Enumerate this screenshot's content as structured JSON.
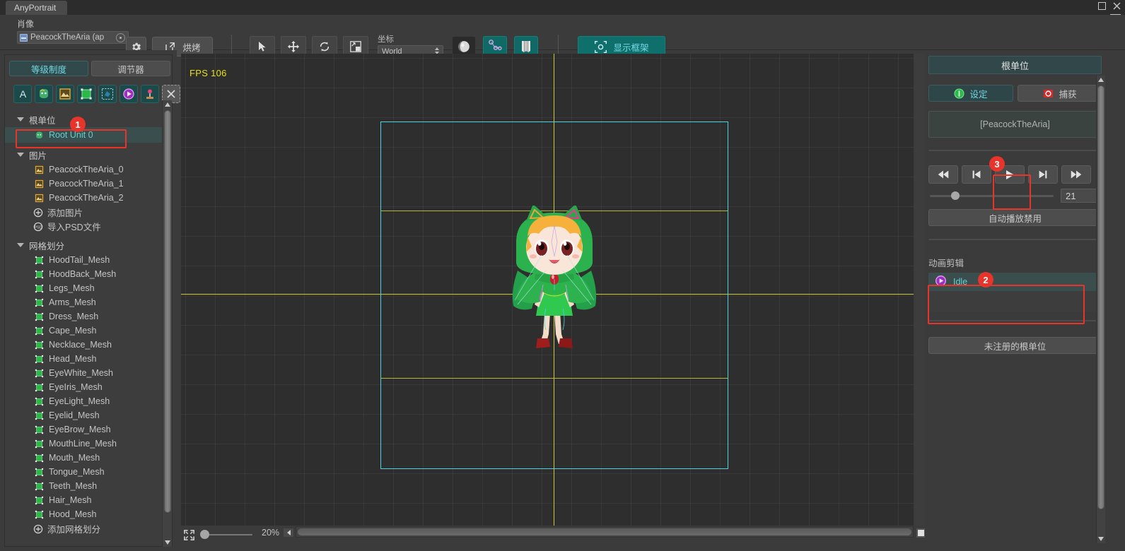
{
  "window": {
    "tab_title": "AnyPortrait",
    "maximize_icon": "maximize-icon",
    "close_icon": "close-icon",
    "menu_icon": "hamburger-menu-icon"
  },
  "toolbar": {
    "portrait_label": "肖像",
    "portrait_value": "PeacockTheAria (ap",
    "object_icon": "asset-icon",
    "picker_icon": "object-picker-icon",
    "settings_icon": "gear-icon",
    "bake_label": "烘烤",
    "bake_icon": "external-link-icon",
    "tools": [
      {
        "name": "select-tool",
        "icon": "cursor-arrow-icon"
      },
      {
        "name": "move-tool",
        "icon": "move-arrows-icon"
      },
      {
        "name": "rotate-tool",
        "icon": "rotate-icon"
      },
      {
        "name": "scale-tool",
        "icon": "scale-icon"
      }
    ],
    "coord_label": "坐标",
    "coord_value": "World",
    "mode_buttons": [
      {
        "name": "mesh-mode-button",
        "icon": "sphere-icon",
        "state": "selected"
      },
      {
        "name": "bone-mode-button",
        "icon": "bone-chain-icon",
        "state": "normal"
      },
      {
        "name": "physics-mode-button",
        "icon": "cloth-icon",
        "state": "normal"
      }
    ],
    "show_frame_label": "显示框架",
    "show_frame_icon": "camera-frame-icon"
  },
  "left_panel": {
    "tabs": [
      {
        "label": "等级制度",
        "active": true
      },
      {
        "label": "调节器",
        "active": false
      }
    ],
    "icon_row": [
      "text-tool-icon",
      "character-icon",
      "image-icon",
      "mesh-icon",
      "mesh-group-icon",
      "animation-icon",
      "control-param-icon",
      "deselect-icon"
    ],
    "groups": [
      {
        "label": "根单位",
        "items": [
          {
            "label": "Root Unit 0",
            "icon": "root-unit-icon",
            "selected": true
          }
        ]
      },
      {
        "label": "图片",
        "items": [
          {
            "label": "PeacockTheAria_0",
            "icon": "image-icon",
            "selected": false
          },
          {
            "label": "PeacockTheAria_1",
            "icon": "image-icon",
            "selected": false
          },
          {
            "label": "PeacockTheAria_2",
            "icon": "image-icon",
            "selected": false
          },
          {
            "label": "添加图片",
            "icon": "plus-circle-icon",
            "selected": false
          },
          {
            "label": "导入PSD文件",
            "icon": "psd-icon",
            "selected": false
          }
        ]
      },
      {
        "label": "网格划分",
        "items": [
          {
            "label": "HoodTail_Mesh",
            "icon": "mesh-icon",
            "selected": false
          },
          {
            "label": "HoodBack_Mesh",
            "icon": "mesh-icon",
            "selected": false
          },
          {
            "label": "Legs_Mesh",
            "icon": "mesh-icon",
            "selected": false
          },
          {
            "label": "Arms_Mesh",
            "icon": "mesh-icon",
            "selected": false
          },
          {
            "label": "Dress_Mesh",
            "icon": "mesh-icon",
            "selected": false
          },
          {
            "label": "Cape_Mesh",
            "icon": "mesh-icon",
            "selected": false
          },
          {
            "label": "Necklace_Mesh",
            "icon": "mesh-icon",
            "selected": false
          },
          {
            "label": "Head_Mesh",
            "icon": "mesh-icon",
            "selected": false
          },
          {
            "label": "EyeWhite_Mesh",
            "icon": "mesh-icon",
            "selected": false
          },
          {
            "label": "EyeIris_Mesh",
            "icon": "mesh-icon",
            "selected": false
          },
          {
            "label": "EyeLight_Mesh",
            "icon": "mesh-icon",
            "selected": false
          },
          {
            "label": "Eyelid_Mesh",
            "icon": "mesh-icon",
            "selected": false
          },
          {
            "label": "EyeBrow_Mesh",
            "icon": "mesh-icon",
            "selected": false
          },
          {
            "label": "MouthLine_Mesh",
            "icon": "mesh-icon",
            "selected": false
          },
          {
            "label": "Mouth_Mesh",
            "icon": "mesh-icon",
            "selected": false
          },
          {
            "label": "Tongue_Mesh",
            "icon": "mesh-icon",
            "selected": false
          },
          {
            "label": "Teeth_Mesh",
            "icon": "mesh-icon",
            "selected": false
          },
          {
            "label": "Hair_Mesh",
            "icon": "mesh-icon",
            "selected": false
          },
          {
            "label": "Hood_Mesh",
            "icon": "mesh-icon",
            "selected": false
          },
          {
            "label": "添加网格划分",
            "icon": "plus-circle-icon",
            "selected": false
          }
        ]
      }
    ]
  },
  "canvas": {
    "fps_text": "FPS 106",
    "zoom_text": "20%",
    "fit_icon": "fit-to-screen-icon",
    "guide_cyan_color": "#4fd2e0",
    "guide_yellow_color": "#c9c93c"
  },
  "right_panel": {
    "title": "根单位",
    "segments": [
      {
        "label": "设定",
        "icon": "info-icon",
        "active": true
      },
      {
        "label": "捕获",
        "icon": "capture-icon",
        "active": false
      }
    ],
    "unit_name": "[PeacockTheAria]",
    "transport": [
      {
        "name": "go-to-start-button",
        "icon": "skip-back-icon"
      },
      {
        "name": "previous-frame-button",
        "icon": "step-back-icon"
      },
      {
        "name": "play-button",
        "icon": "play-icon"
      },
      {
        "name": "next-frame-button",
        "icon": "step-forward-icon"
      },
      {
        "name": "go-to-end-button",
        "icon": "skip-forward-icon"
      }
    ],
    "frame_value": "21",
    "autoplay_label": "自动播放禁用",
    "clips_label": "动画剪辑",
    "clips": [
      {
        "label": "Idle",
        "icon": "animation-clip-icon",
        "selected": true
      }
    ],
    "unregistered_label": "未注册的根单位"
  },
  "annotations": [
    {
      "number": "1",
      "target": "root-unit-row"
    },
    {
      "number": "2",
      "target": "animation-clip-idle"
    },
    {
      "number": "3",
      "target": "play-button"
    }
  ],
  "colors": {
    "accent_teal": "#6fd8e4",
    "highlight_red": "#e8342b",
    "fps_yellow": "#e8e019",
    "panel_bg": "#3b3b3b"
  }
}
